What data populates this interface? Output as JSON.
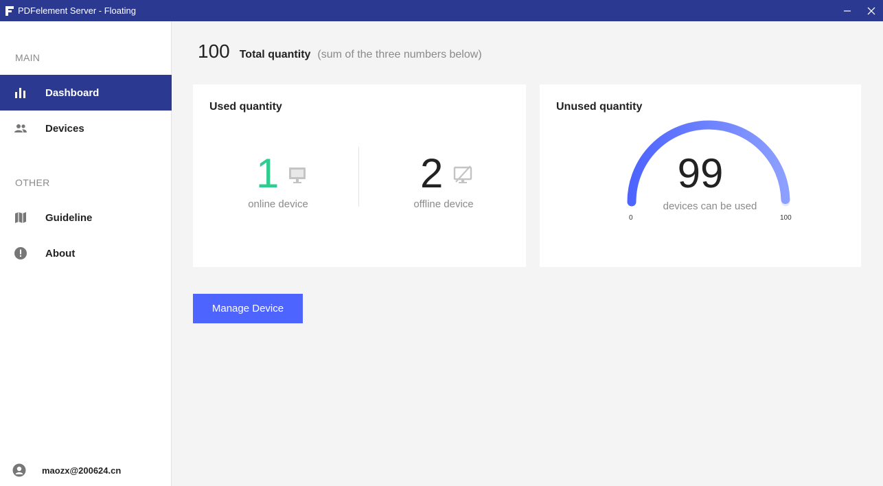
{
  "window": {
    "title": "PDFelement Server - Floating",
    "minimize_label": "—",
    "close_label": "✕"
  },
  "sidebar": {
    "main_label": "MAIN",
    "other_label": "OTHER",
    "items": [
      {
        "label": "Dashboard",
        "icon": "bar-chart-icon",
        "active": true
      },
      {
        "label": "Devices",
        "icon": "users-icon",
        "active": false
      },
      {
        "label": "Guideline",
        "icon": "map-icon",
        "active": false
      },
      {
        "label": "About",
        "icon": "info-icon",
        "active": false
      }
    ],
    "user_email": "maozx@200624.cn"
  },
  "summary": {
    "total_value": "100",
    "total_label": "Total quantity",
    "total_note": "(sum of the three numbers below)"
  },
  "used_card": {
    "title": "Used quantity",
    "online_value": "1",
    "online_label": "online device",
    "offline_value": "2",
    "offline_label": "offline device"
  },
  "unused_card": {
    "title": "Unused quantity",
    "value": "99",
    "label": "devices can be used",
    "min_label": "0",
    "max_label": "100",
    "fill_fraction": 0.99
  },
  "actions": {
    "manage_label": "Manage Device"
  },
  "colors": {
    "titlebar": "#2b3990",
    "accent": "#4e64ff",
    "online": "#2ecc8f",
    "gauge_start": "#4e64ff",
    "gauge_end": "#8da0ff"
  }
}
